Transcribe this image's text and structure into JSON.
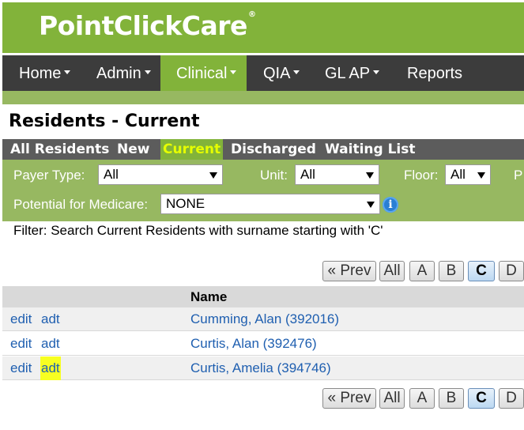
{
  "app": {
    "logo": "PointClickCare",
    "logo_mark": "®"
  },
  "nav": {
    "items": [
      {
        "label": "Home",
        "has_menu": true
      },
      {
        "label": "Admin",
        "has_menu": true
      },
      {
        "label": "Clinical",
        "has_menu": true,
        "active": true
      },
      {
        "label": "QIA",
        "has_menu": true
      },
      {
        "label": "GL AP",
        "has_menu": true
      },
      {
        "label": "Reports",
        "has_menu": false
      }
    ]
  },
  "page": {
    "title": "Residents - Current"
  },
  "tabs": [
    {
      "label": "All Residents"
    },
    {
      "label": "New"
    },
    {
      "label": "Current",
      "active": true
    },
    {
      "label": "Discharged"
    },
    {
      "label": "Waiting List"
    }
  ],
  "filters": {
    "payer_type": {
      "label": "Payer Type:",
      "value": "All"
    },
    "unit": {
      "label": "Unit:",
      "value": "All"
    },
    "floor": {
      "label": "Floor:",
      "value": "All"
    },
    "cutoff_label": "P",
    "medicare": {
      "label": "Potential for Medicare:",
      "value": "NONE"
    },
    "description": "Filter: Search Current Residents with surname starting with 'C'"
  },
  "pager": {
    "prev": "« Prev",
    "all": "All",
    "letters": [
      "A",
      "B",
      "C",
      "D"
    ],
    "active_letter": "C"
  },
  "table": {
    "headers": {
      "name": "Name"
    },
    "rows": [
      {
        "edit": "edit",
        "adt": "adt",
        "name": "Cumming, Alan (392016)"
      },
      {
        "edit": "edit",
        "adt": "adt",
        "name": "Curtis, Alan (392476)"
      },
      {
        "edit": "edit",
        "adt": "adt",
        "name": "Curtis, Amelia (394746)",
        "adt_highlighted": true
      }
    ]
  },
  "colors": {
    "brand_green": "#82b33a",
    "nav_dark": "#3c3c3c",
    "tab_active_text": "#e6ff00",
    "link_blue": "#1f5fb0",
    "highlight": "#f7ff21"
  }
}
